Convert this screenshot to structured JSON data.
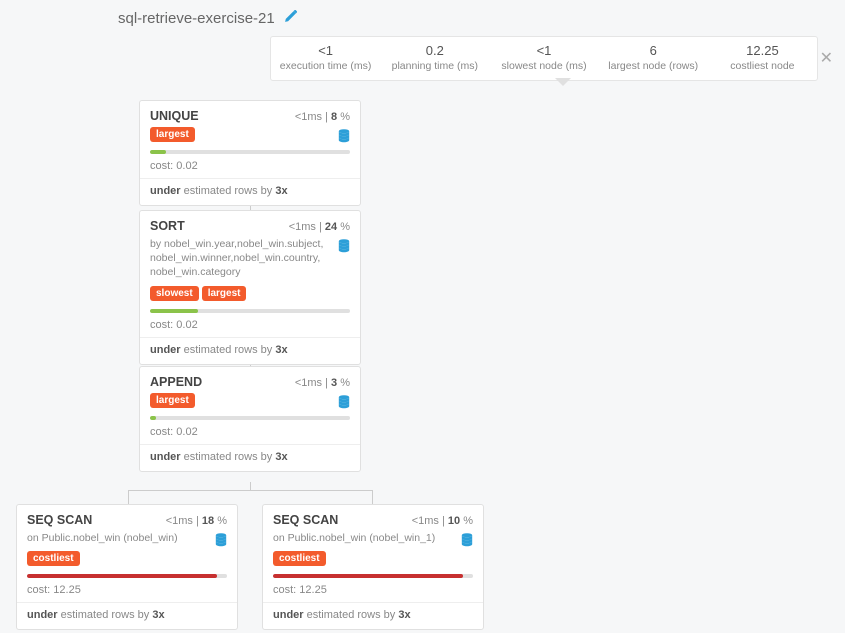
{
  "title": "sql-retrieve-exercise-21",
  "stats": [
    {
      "value": "<1",
      "label": "execution time (ms)"
    },
    {
      "value": "0.2",
      "label": "planning time (ms)"
    },
    {
      "value": "<1",
      "label": "slowest node (ms)"
    },
    {
      "value": "6",
      "label": "largest node (rows)"
    },
    {
      "value": "12.25",
      "label": "costliest node"
    }
  ],
  "nodes": {
    "unique": {
      "title": "UNIQUE",
      "time": "<1ms",
      "pct": "8",
      "badges": [
        "largest"
      ],
      "bar_pct": 8,
      "bar_color": "green",
      "cost": "cost: 0.02",
      "est_prefix": "under",
      "est_mid": " estimated rows by ",
      "est_factor": "3x"
    },
    "sort": {
      "title": "SORT",
      "time": "<1ms",
      "pct": "24",
      "sub": "by nobel_win.year,nobel_win.subject, nobel_win.winner,nobel_win.country, nobel_win.category",
      "badges": [
        "slowest",
        "largest"
      ],
      "bar_pct": 24,
      "bar_color": "green",
      "cost": "cost: 0.02",
      "est_prefix": "under",
      "est_mid": " estimated rows by ",
      "est_factor": "3x"
    },
    "append": {
      "title": "APPEND",
      "time": "<1ms",
      "pct": "3",
      "badges": [
        "largest"
      ],
      "bar_pct": 3,
      "bar_color": "green",
      "cost": "cost: 0.02",
      "est_prefix": "under",
      "est_mid": " estimated rows by ",
      "est_factor": "3x"
    },
    "seq1": {
      "title": "SEQ SCAN",
      "time": "<1ms",
      "pct": "18",
      "sub": "on Public.nobel_win (nobel_win)",
      "badges": [
        "costliest"
      ],
      "bar_pct": 95,
      "bar_color": "red",
      "cost": "cost: 12.25",
      "est_prefix": "under",
      "est_mid": " estimated rows by ",
      "est_factor": "3x"
    },
    "seq2": {
      "title": "SEQ SCAN",
      "time": "<1ms",
      "pct": "10",
      "sub": "on Public.nobel_win (nobel_win_1)",
      "badges": [
        "costliest"
      ],
      "bar_pct": 95,
      "bar_color": "red",
      "cost": "cost: 12.25",
      "est_prefix": "under",
      "est_mid": " estimated rows by ",
      "est_factor": "3x"
    }
  }
}
